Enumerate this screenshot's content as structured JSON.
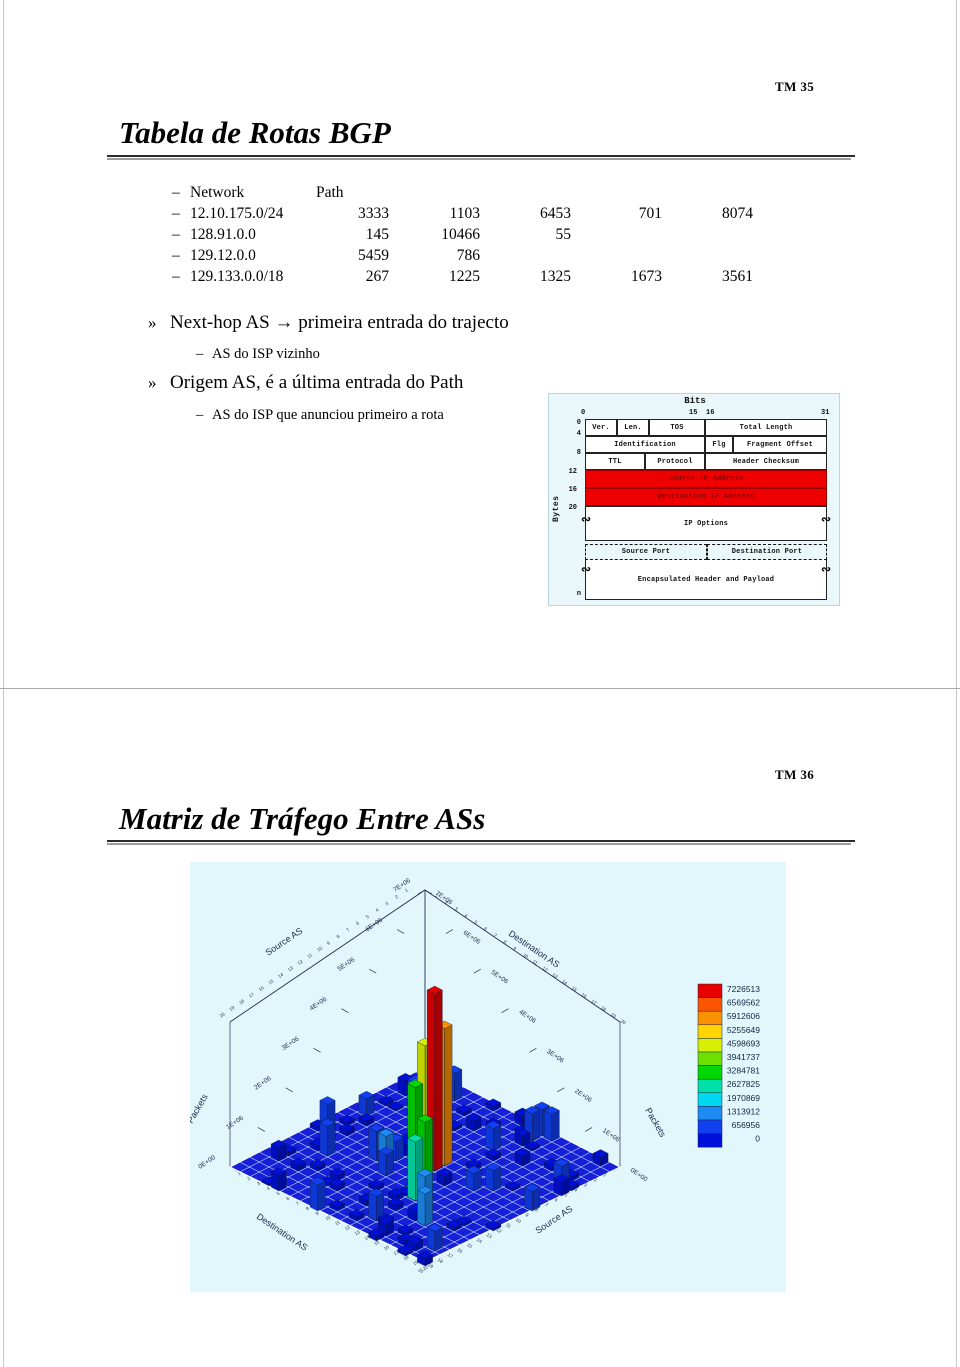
{
  "slide1": {
    "number": "TM 35",
    "title": "Tabela de Rotas BGP",
    "table": {
      "headers": [
        "Network",
        "Path"
      ],
      "rows": [
        {
          "network": "12.10.175.0/24",
          "path": [
            "3333",
            "1103",
            "6453",
            "701",
            "8074"
          ]
        },
        {
          "network": "128.91.0.0",
          "path": [
            "145",
            "10466",
            "55",
            "",
            ""
          ]
        },
        {
          "network": "129.12.0.0",
          "path": [
            "5459",
            "786",
            "",
            "",
            ""
          ]
        },
        {
          "network": "129.133.0.0/18",
          "path": [
            "267",
            "1225",
            "1325",
            "1673",
            "3561"
          ]
        }
      ],
      "dash": "–"
    },
    "bullets": [
      {
        "marker": "»",
        "text": "Next-hop AS → primeira entrada do trajecto"
      },
      {
        "marker": "–",
        "text": "AS do ISP vizinho"
      },
      {
        "marker": "»",
        "text": "Origem AS, é a última entrada do Path"
      },
      {
        "marker": "–",
        "text": "AS do ISP que anunciou primeiro a rota"
      }
    ],
    "ip_figure": {
      "bits_title": "Bits",
      "bit_ticks": [
        "0",
        "15",
        "16",
        "31"
      ],
      "byte_ticks": [
        "0",
        "4",
        "8",
        "12",
        "16",
        "20",
        "n"
      ],
      "bytes_axis_label": "Bytes",
      "row1": [
        "Ver.",
        "Len.",
        "TOS",
        "Total Length"
      ],
      "row2": [
        "Identification",
        "Flg",
        "Fragment Offset"
      ],
      "row3": [
        "TTL",
        "Protocol",
        "Header Checksum"
      ],
      "row4": "Source IP Address",
      "row5": "Destination IP Address",
      "row6": "IP Options",
      "row7": [
        "Source Port",
        "Destination Port"
      ],
      "row8": "Encapsulated Header and Payload",
      "highlight_color": "#ee0000"
    }
  },
  "slide2": {
    "number": "TM 36",
    "title": "Matriz de Tráfego Entre ASs",
    "chart_data": {
      "type": "bar",
      "title": "Matriz de Tráfego Entre ASs",
      "projection": "3d-surface-bars",
      "xlabel_top_left": "Source AS",
      "xlabel_top_right": "Destination AS",
      "xlabel_bottom_left": "Destination AS",
      "xlabel_bottom_right": "Source AS",
      "zlabel_left": "Packets",
      "zlabel_right": "Packets",
      "background": "#e2f7fc",
      "grid": true,
      "zlim": [
        0,
        7226513
      ],
      "z_ticks": [
        "0E+00",
        "1E+06",
        "2E+06",
        "3E+06",
        "4E+06",
        "5E+06",
        "6E+06",
        "7E+06"
      ],
      "legend_position": "right",
      "legend_title": "",
      "legend_entries": [
        {
          "value": "7226513",
          "color": "#e60000"
        },
        {
          "value": "6569562",
          "color": "#fb5500"
        },
        {
          "value": "5912606",
          "color": "#fb9000"
        },
        {
          "value": "5255649",
          "color": "#ffd400"
        },
        {
          "value": "4598693",
          "color": "#d8f000"
        },
        {
          "value": "3941737",
          "color": "#6de000"
        },
        {
          "value": "3284781",
          "color": "#00d800"
        },
        {
          "value": "2627825",
          "color": "#00e0a8"
        },
        {
          "value": "1970869",
          "color": "#00d8f0"
        },
        {
          "value": "1313912",
          "color": "#1c8cf0"
        },
        {
          "value": "656956",
          "color": "#1040f0"
        },
        {
          "value": "0",
          "color": "#0010d8"
        }
      ],
      "grid_size": [
        20,
        20
      ],
      "peaks": [
        {
          "row": 9,
          "col": 10,
          "value": 7226513,
          "color": "#e60000"
        },
        {
          "row": 9,
          "col": 9,
          "value": 4900000,
          "color": "#d8f000"
        },
        {
          "row": 10,
          "col": 9,
          "value": 3400000,
          "color": "#00d800"
        },
        {
          "row": 8,
          "col": 10,
          "value": 5600000,
          "color": "#fb9000"
        },
        {
          "row": 12,
          "col": 12,
          "value": 3000000,
          "color": "#00d800"
        },
        {
          "row": 13,
          "col": 12,
          "value": 2400000,
          "color": "#00e0a8"
        },
        {
          "row": 5,
          "col": 6,
          "value": 1500000,
          "color": "#1c8cf0"
        },
        {
          "row": 6,
          "col": 6,
          "value": 1400000,
          "color": "#1c8cf0"
        },
        {
          "row": 14,
          "col": 14,
          "value": 1600000,
          "color": "#1c8cf0"
        },
        {
          "row": 15,
          "col": 15,
          "value": 1300000,
          "color": "#1c8cf0"
        },
        {
          "row": 11,
          "col": 7,
          "value": 1200000,
          "color": "#1c8cf0"
        },
        {
          "row": 4,
          "col": 3,
          "value": 1000000,
          "color": "#1c8cf0"
        }
      ],
      "source_as_categories": [
        "1",
        "2",
        "3",
        "4",
        "5",
        "6",
        "7",
        "8",
        "9",
        "10",
        "11",
        "12",
        "13",
        "14",
        "15",
        "16",
        "17",
        "18",
        "19",
        "20"
      ],
      "destination_as_categories": [
        "1",
        "2",
        "3",
        "4",
        "5",
        "6",
        "7",
        "8",
        "9",
        "10",
        "11",
        "12",
        "13",
        "14",
        "15",
        "16",
        "17",
        "18",
        "19",
        "20"
      ]
    }
  }
}
